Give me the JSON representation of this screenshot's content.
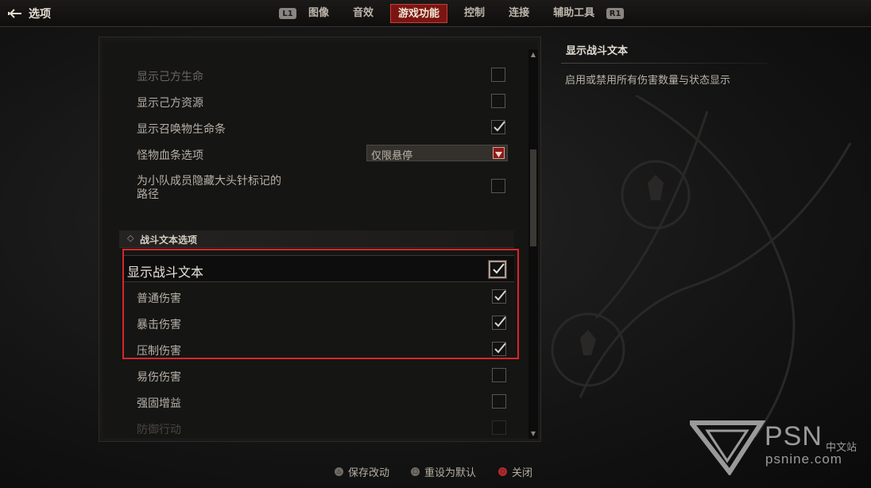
{
  "header": {
    "back_label": "选项",
    "left_shoulder": "L1",
    "right_shoulder": "R1",
    "tabs": [
      {
        "label": "图像",
        "active": false
      },
      {
        "label": "音效",
        "active": false
      },
      {
        "label": "游戏功能",
        "active": true
      },
      {
        "label": "控制",
        "active": false
      },
      {
        "label": "连接",
        "active": false
      },
      {
        "label": "辅助工具",
        "active": false
      }
    ]
  },
  "settings_upper": [
    {
      "label": "显示己方生命",
      "checked": false
    },
    {
      "label": "显示己方资源",
      "checked": false
    },
    {
      "label": "显示召唤物生命条",
      "checked": true
    },
    {
      "label": "怪物血条选项",
      "type": "select",
      "value": "仅限悬停"
    },
    {
      "label_line1": "为小队成员隐藏大头针标记的",
      "label_line2": "路径",
      "checked": false
    }
  ],
  "combat_section": {
    "title": "战斗文本选项",
    "main": {
      "label": "显示战斗文本",
      "checked": true
    },
    "items": [
      {
        "label": "普通伤害",
        "checked": true
      },
      {
        "label": "暴击伤害",
        "checked": true
      },
      {
        "label": "压制伤害",
        "checked": true
      },
      {
        "label": "易伤伤害",
        "checked": false
      },
      {
        "label": "强固增益",
        "checked": false
      },
      {
        "label": "防御行动",
        "checked": false
      }
    ]
  },
  "info": {
    "title": "显示战斗文本",
    "description": "启用或禁用所有伤害数量与状态显示"
  },
  "footer": {
    "save": "保存改动",
    "reset": "重设为默认",
    "close": "关闭"
  },
  "watermark": {
    "brand": "PSN",
    "subtitle": "中文站",
    "url": "psnine.com"
  },
  "colors": {
    "accent_red": "#7b1512",
    "highlight_box": "#d6262c"
  }
}
